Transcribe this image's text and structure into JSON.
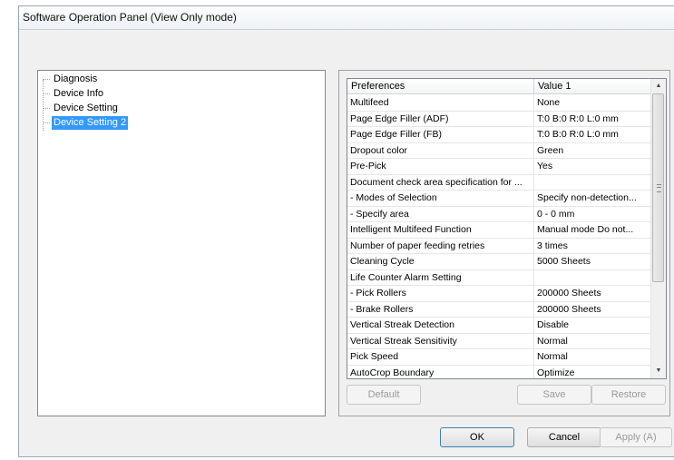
{
  "window": {
    "title": "Software Operation Panel (View Only mode)"
  },
  "tree": {
    "items": [
      {
        "label": "Diagnosis",
        "selected": false
      },
      {
        "label": "Device Info",
        "selected": false
      },
      {
        "label": "Device Setting",
        "selected": false
      },
      {
        "label": "Device Setting 2",
        "selected": true
      }
    ]
  },
  "grid": {
    "headers": [
      "Preferences",
      "Value 1"
    ],
    "rows": [
      [
        "Multifeed",
        "None"
      ],
      [
        "Page Edge Filler (ADF)",
        "T:0  B:0  R:0  L:0 mm"
      ],
      [
        "Page Edge Filler (FB)",
        "T:0  B:0  R:0  L:0 mm"
      ],
      [
        "Dropout color",
        "Green"
      ],
      [
        "Pre-Pick",
        "Yes"
      ],
      [
        "Document check area specification for ...",
        ""
      ],
      [
        " - Modes of Selection",
        "Specify non-detection..."
      ],
      [
        " - Specify area",
        "0 - 0 mm"
      ],
      [
        "Intelligent Multifeed Function",
        "Manual mode  Do not..."
      ],
      [
        "Number of paper feeding retries",
        "3 times"
      ],
      [
        "Cleaning Cycle",
        "5000 Sheets"
      ],
      [
        "Life Counter Alarm Setting",
        ""
      ],
      [
        " - Pick Rollers",
        "200000 Sheets"
      ],
      [
        " - Brake Rollers",
        "200000 Sheets"
      ],
      [
        "Vertical Streak Detection",
        "Disable"
      ],
      [
        "Vertical Streak Sensitivity",
        "Normal"
      ],
      [
        "Pick Speed",
        "Normal"
      ],
      [
        "AutoCrop Boundary",
        "Optimize"
      ]
    ]
  },
  "group_buttons": {
    "default_label": "Default",
    "save_label": "Save",
    "restore_label": "Restore"
  },
  "dialog_buttons": {
    "ok_label": "OK",
    "cancel_label": "Cancel",
    "apply_label": "Apply (A)"
  },
  "colors": {
    "selection": "#3399ff",
    "window_bg": "#f0f0f0"
  }
}
